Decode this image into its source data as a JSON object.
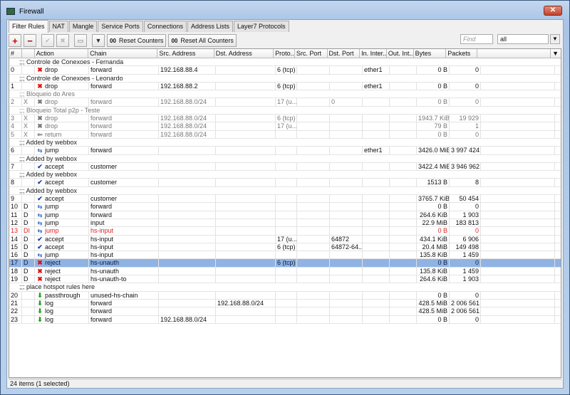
{
  "window": {
    "title": "Firewall",
    "close": "✕"
  },
  "tabs": [
    "Filter Rules",
    "NAT",
    "Mangle",
    "Service Ports",
    "Connections",
    "Address Lists",
    "Layer7 Protocols"
  ],
  "toolbar": {
    "add": "+",
    "remove": "−",
    "enable": "✔",
    "disable": "✖",
    "comment": "▭",
    "filter": "▼",
    "reset_counters": "Reset Counters",
    "reset_all_counters": "Reset All Counters",
    "oo": "00",
    "find_placeholder": "Find",
    "filter_value": "all",
    "filter_arrow": "▼"
  },
  "columns": [
    "#",
    "",
    "Action",
    "Chain",
    "Src. Address",
    "Dst. Address",
    "Proto...",
    "Src. Port",
    "Dst. Port",
    "In. Inter...",
    "Out. Int...",
    "Bytes",
    "Packets",
    "",
    "▼"
  ],
  "rows": [
    {
      "comment": ";;; Controle de Conexoes - Fernanda"
    },
    {
      "n": "0",
      "f": "",
      "action": "drop",
      "chain": "forward",
      "src": "192.168.88.4",
      "dst": "",
      "proto": "6 (tcp)",
      "sport": "",
      "dport": "",
      "in": "ether1",
      "out": "",
      "bytes": "0 B",
      "packets": "0"
    },
    {
      "comment": ";;; Controle de Conexoes - Leonardo"
    },
    {
      "n": "1",
      "f": "",
      "action": "drop",
      "chain": "forward",
      "src": "192.168.88.2",
      "dst": "",
      "proto": "6 (tcp)",
      "sport": "",
      "dport": "",
      "in": "ether1",
      "out": "",
      "bytes": "0 B",
      "packets": "0"
    },
    {
      "comment": ";;; Bloqueio do Ares",
      "state": "disabled"
    },
    {
      "n": "2",
      "f": "X",
      "action": "drop",
      "chain": "forward",
      "src": "192.168.88.0/24",
      "dst": "",
      "proto": "17 (u...",
      "sport": "",
      "dport": "0",
      "in": "",
      "out": "",
      "bytes": "0 B",
      "packets": "0",
      "state": "disabled"
    },
    {
      "comment": ";;; Bloqueio Total p2p - Teste",
      "state": "disabled"
    },
    {
      "n": "3",
      "f": "X",
      "action": "drop",
      "chain": "forward",
      "src": "192.168.88.0/24",
      "dst": "",
      "proto": "6 (tcp)",
      "sport": "",
      "dport": "",
      "in": "",
      "out": "",
      "bytes": "1943.7 KiB",
      "packets": "19 929",
      "state": "disabled"
    },
    {
      "n": "4",
      "f": "X",
      "action": "drop",
      "chain": "forward",
      "src": "192.168.88.0/24",
      "dst": "",
      "proto": "17 (u...",
      "sport": "",
      "dport": "",
      "in": "",
      "out": "",
      "bytes": "79 B",
      "packets": "1",
      "state": "disabled"
    },
    {
      "n": "5",
      "f": "X",
      "action": "return",
      "chain": "forward",
      "src": "192.168.88.0/24",
      "dst": "",
      "proto": "",
      "sport": "",
      "dport": "",
      "in": "",
      "out": "",
      "bytes": "0 B",
      "packets": "0",
      "state": "disabled"
    },
    {
      "comment": ";;; Added by webbox"
    },
    {
      "n": "6",
      "f": "",
      "action": "jump",
      "chain": "forward",
      "src": "",
      "dst": "",
      "proto": "",
      "sport": "",
      "dport": "",
      "in": "ether1",
      "out": "",
      "bytes": "3426.0 MiB",
      "packets": "3 997 424"
    },
    {
      "comment": ";;; Added by webbox"
    },
    {
      "n": "7",
      "f": "",
      "action": "accept",
      "chain": "customer",
      "src": "",
      "dst": "",
      "proto": "",
      "sport": "",
      "dport": "",
      "in": "",
      "out": "",
      "bytes": "3422.4 MiB",
      "packets": "3 946 962"
    },
    {
      "comment": ";;; Added by webbox"
    },
    {
      "n": "8",
      "f": "",
      "action": "accept",
      "chain": "customer",
      "src": "",
      "dst": "",
      "proto": "",
      "sport": "",
      "dport": "",
      "in": "",
      "out": "",
      "bytes": "1513 B",
      "packets": "8"
    },
    {
      "comment": ";;; Added by webbox"
    },
    {
      "n": "9",
      "f": "",
      "action": "accept",
      "chain": "customer",
      "src": "",
      "dst": "",
      "proto": "",
      "sport": "",
      "dport": "",
      "in": "",
      "out": "",
      "bytes": "3765.7 KiB",
      "packets": "50 454"
    },
    {
      "n": "10",
      "f": "D",
      "action": "jump",
      "chain": "forward",
      "src": "",
      "dst": "",
      "proto": "",
      "sport": "",
      "dport": "",
      "in": "",
      "out": "",
      "bytes": "0 B",
      "packets": "0"
    },
    {
      "n": "11",
      "f": "D",
      "action": "jump",
      "chain": "forward",
      "src": "",
      "dst": "",
      "proto": "",
      "sport": "",
      "dport": "",
      "in": "",
      "out": "",
      "bytes": "264.6 KiB",
      "packets": "1 903"
    },
    {
      "n": "12",
      "f": "D",
      "action": "jump",
      "chain": "input",
      "src": "",
      "dst": "",
      "proto": "",
      "sport": "",
      "dport": "",
      "in": "",
      "out": "",
      "bytes": "22.9 MiB",
      "packets": "183 813"
    },
    {
      "n": "13",
      "f": "DI",
      "action": "jump",
      "chain": "hs-input",
      "src": "",
      "dst": "",
      "proto": "",
      "sport": "",
      "dport": "",
      "in": "",
      "out": "",
      "bytes": "0 B",
      "packets": "0",
      "state": "invalid"
    },
    {
      "n": "14",
      "f": "D",
      "action": "accept",
      "chain": "hs-input",
      "src": "",
      "dst": "",
      "proto": "17 (u...",
      "sport": "",
      "dport": "64872",
      "in": "",
      "out": "",
      "bytes": "434.1 KiB",
      "packets": "6 906"
    },
    {
      "n": "15",
      "f": "D",
      "action": "accept",
      "chain": "hs-input",
      "src": "",
      "dst": "",
      "proto": "6 (tcp)",
      "sport": "",
      "dport": "64872-64...",
      "in": "",
      "out": "",
      "bytes": "20.4 MiB",
      "packets": "149 498"
    },
    {
      "n": "16",
      "f": "D",
      "action": "jump",
      "chain": "hs-input",
      "src": "",
      "dst": "",
      "proto": "",
      "sport": "",
      "dport": "",
      "in": "",
      "out": "",
      "bytes": "135.8 KiB",
      "packets": "1 459"
    },
    {
      "n": "17",
      "f": "D",
      "action": "reject",
      "chain": "hs-unauth",
      "src": "",
      "dst": "",
      "proto": "6 (tcp)",
      "sport": "",
      "dport": "",
      "in": "",
      "out": "",
      "bytes": "0 B",
      "packets": "0",
      "state": "selected"
    },
    {
      "n": "18",
      "f": "D",
      "action": "reject",
      "chain": "hs-unauth",
      "src": "",
      "dst": "",
      "proto": "",
      "sport": "",
      "dport": "",
      "in": "",
      "out": "",
      "bytes": "135.8 KiB",
      "packets": "1 459"
    },
    {
      "n": "19",
      "f": "D",
      "action": "reject",
      "chain": "hs-unauth-to",
      "src": "",
      "dst": "",
      "proto": "",
      "sport": "",
      "dport": "",
      "in": "",
      "out": "",
      "bytes": "264.6 KiB",
      "packets": "1 903"
    },
    {
      "comment": ";;; place hotspot rules here"
    },
    {
      "n": "20",
      "f": "",
      "action": "passthrough",
      "chain": "unused-hs-chain",
      "src": "",
      "dst": "",
      "proto": "",
      "sport": "",
      "dport": "",
      "in": "",
      "out": "",
      "bytes": "0 B",
      "packets": "0"
    },
    {
      "n": "21",
      "f": "",
      "action": "log",
      "chain": "forward",
      "src": "",
      "dst": "192.168.88.0/24",
      "proto": "",
      "sport": "",
      "dport": "",
      "in": "",
      "out": "",
      "bytes": "428.5 MiB",
      "packets": "2 006 561"
    },
    {
      "n": "22",
      "f": "",
      "action": "log",
      "chain": "forward",
      "src": "",
      "dst": "",
      "proto": "",
      "sport": "",
      "dport": "",
      "in": "",
      "out": "",
      "bytes": "428.5 MiB",
      "packets": "2 006 561"
    },
    {
      "n": "23",
      "f": "",
      "action": "log",
      "chain": "forward",
      "src": "192.168.88.0/24",
      "dst": "",
      "proto": "",
      "sport": "",
      "dport": "",
      "in": "",
      "out": "",
      "bytes": "0 B",
      "packets": "0"
    }
  ],
  "icons": {
    "drop": "✖",
    "reject": "✖",
    "accept": "✔",
    "jump": "⇆",
    "log": "⬇",
    "passthrough": "⬇",
    "return": "⇐"
  },
  "status": "24 items (1 selected)"
}
